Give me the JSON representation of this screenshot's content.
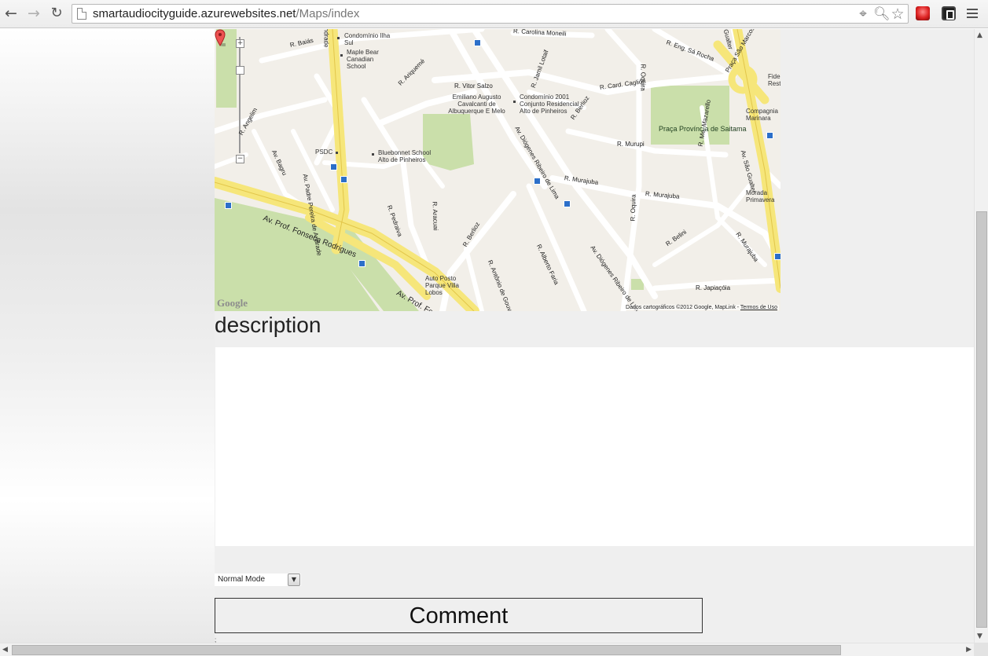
{
  "browser": {
    "url_host": "smartaudiocityguide.azurewebsites.net",
    "url_path": "/Maps/index",
    "back_icon": "back-arrow-icon",
    "forward_icon": "forward-arrow-icon",
    "reload_icon": "reload-icon"
  },
  "map": {
    "zoom_in": "+",
    "zoom_out": "−",
    "google_logo": "Google",
    "attribution_text": "Dados cartográficos ©2012 Google, MapLink - ",
    "attribution_link": "Termos de Uso",
    "streets": [
      "R. Carolina Moneili",
      "R. Eng. Sá Rocha",
      "R. Baiás",
      "R. Ariquemé",
      "R. Vitor Salzo",
      "R. Jamil Lotaif",
      "R. Oquira",
      "R. Card. Cagliori",
      "Praça São Marcos",
      "Av. Padre Pereira de Andrade",
      "R. Angelim",
      "Av. Bagru",
      "R. Berlioz",
      "R. Murupi",
      "R. Murajuba",
      "R. Murajuba",
      "Av. Diógenes Ribeiro de Lima",
      "R. Me. Mazarello",
      "Av. São Gualter",
      "R. Pedraiva",
      "R. Aracuai",
      "Av. Prof. Fonseca Rodrigues",
      "R. Antônio de Gouvea Gi",
      "R. Alberto Faria",
      "Av. Diógenes Ribeiro de Lima",
      "R. Oquira",
      "R. Belini",
      "R. Murajuba",
      "R. Japiaçóia",
      "Av. Prof. Fon",
      "R. Berlioz",
      "ndrade",
      "Gualter"
    ],
    "places": [
      "Condomínio Ilha Sul",
      "Maple Bear Canadian School",
      "Emiliano Augusto Cavalcanti de Albuquerque E Melo",
      "Condomínio 2001 Conjunto Residencial Alto de Pinheiros",
      "PSDC",
      "Bluebonnet School Alto de Pinheiros",
      "Auto Posto Parque Villa Lobos",
      "Compagnia Marinara",
      "Morada Primavera",
      "Fidel Rest"
    ],
    "parks": [
      "Praça Província de Saitama"
    ]
  },
  "content": {
    "description_heading": "description",
    "mode_select_value": "Normal Mode",
    "comment_button": "Comment",
    "small_text": ";"
  }
}
